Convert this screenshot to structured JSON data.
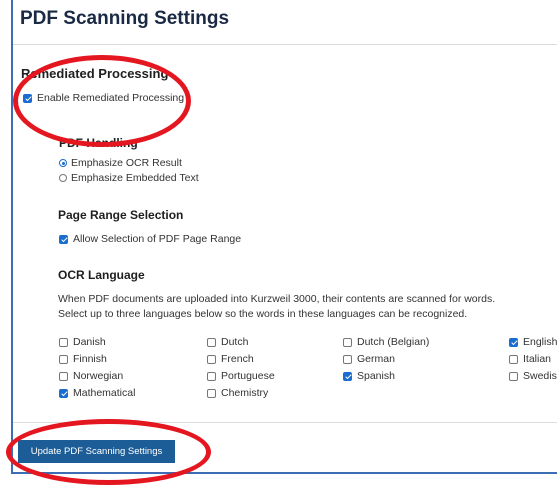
{
  "page": {
    "title": "PDF Scanning Settings"
  },
  "remediated": {
    "heading": "Remediated Processing",
    "enable_label": "Enable Remediated Processing",
    "enable_checked": true
  },
  "pdf_handling": {
    "heading": "PDF Handling",
    "options": [
      {
        "label": "Emphasize OCR Result",
        "selected": true
      },
      {
        "label": "Emphasize Embedded Text",
        "selected": false
      }
    ]
  },
  "page_range": {
    "heading": "Page Range Selection",
    "allow_label": "Allow Selection of PDF Page Range",
    "allow_checked": true
  },
  "ocr": {
    "heading": "OCR Language",
    "desc_line1": "When PDF documents are uploaded into Kurzweil 3000, their contents are scanned for words.",
    "desc_line2": "Select up to three languages below so the words in these languages can be recognized.",
    "languages": [
      {
        "label": "Danish",
        "checked": false
      },
      {
        "label": "Dutch",
        "checked": false
      },
      {
        "label": "Dutch (Belgian)",
        "checked": false
      },
      {
        "label": "English",
        "checked": true
      },
      {
        "label": "Finnish",
        "checked": false
      },
      {
        "label": "French",
        "checked": false
      },
      {
        "label": "German",
        "checked": false
      },
      {
        "label": "Italian",
        "checked": false
      },
      {
        "label": "Norwegian",
        "checked": false
      },
      {
        "label": "Portuguese",
        "checked": false
      },
      {
        "label": "Spanish",
        "checked": true
      },
      {
        "label": "Swedish",
        "checked": false
      },
      {
        "label": "Mathematical",
        "checked": true
      },
      {
        "label": "Chemistry",
        "checked": false
      }
    ]
  },
  "actions": {
    "update_label": "Update PDF Scanning Settings"
  },
  "colors": {
    "accent": "#1a6dd0",
    "button": "#1c5d97",
    "annotation": "#e4161f",
    "frame": "#3c6db5"
  }
}
